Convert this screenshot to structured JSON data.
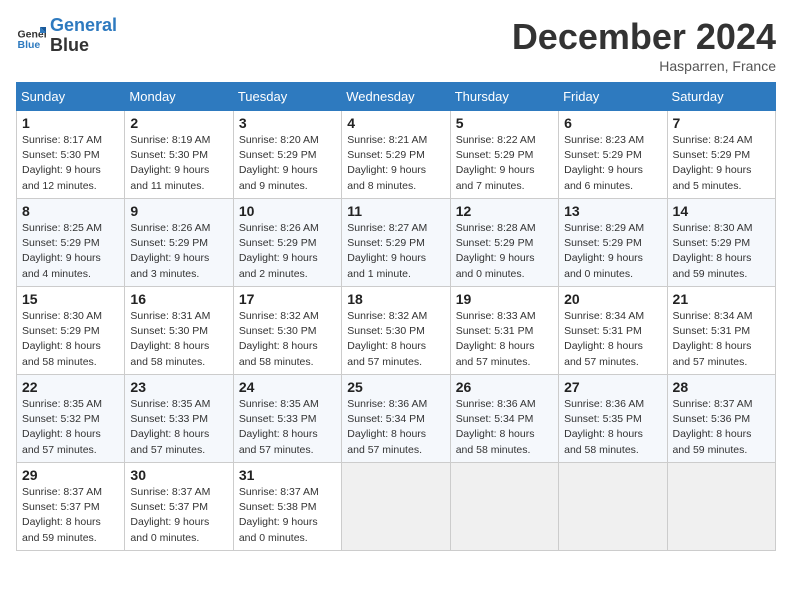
{
  "header": {
    "logo_line1": "General",
    "logo_line2": "Blue",
    "month": "December 2024",
    "location": "Hasparren, France"
  },
  "weekdays": [
    "Sunday",
    "Monday",
    "Tuesday",
    "Wednesday",
    "Thursday",
    "Friday",
    "Saturday"
  ],
  "weeks": [
    [
      {
        "day": 1,
        "sunrise": "8:17 AM",
        "sunset": "5:30 PM",
        "daylight": "9 hours and 12 minutes."
      },
      {
        "day": 2,
        "sunrise": "8:19 AM",
        "sunset": "5:30 PM",
        "daylight": "9 hours and 11 minutes."
      },
      {
        "day": 3,
        "sunrise": "8:20 AM",
        "sunset": "5:29 PM",
        "daylight": "9 hours and 9 minutes."
      },
      {
        "day": 4,
        "sunrise": "8:21 AM",
        "sunset": "5:29 PM",
        "daylight": "9 hours and 8 minutes."
      },
      {
        "day": 5,
        "sunrise": "8:22 AM",
        "sunset": "5:29 PM",
        "daylight": "9 hours and 7 minutes."
      },
      {
        "day": 6,
        "sunrise": "8:23 AM",
        "sunset": "5:29 PM",
        "daylight": "9 hours and 6 minutes."
      },
      {
        "day": 7,
        "sunrise": "8:24 AM",
        "sunset": "5:29 PM",
        "daylight": "9 hours and 5 minutes."
      }
    ],
    [
      {
        "day": 8,
        "sunrise": "8:25 AM",
        "sunset": "5:29 PM",
        "daylight": "9 hours and 4 minutes."
      },
      {
        "day": 9,
        "sunrise": "8:26 AM",
        "sunset": "5:29 PM",
        "daylight": "9 hours and 3 minutes."
      },
      {
        "day": 10,
        "sunrise": "8:26 AM",
        "sunset": "5:29 PM",
        "daylight": "9 hours and 2 minutes."
      },
      {
        "day": 11,
        "sunrise": "8:27 AM",
        "sunset": "5:29 PM",
        "daylight": "9 hours and 1 minute."
      },
      {
        "day": 12,
        "sunrise": "8:28 AM",
        "sunset": "5:29 PM",
        "daylight": "9 hours and 0 minutes."
      },
      {
        "day": 13,
        "sunrise": "8:29 AM",
        "sunset": "5:29 PM",
        "daylight": "9 hours and 0 minutes."
      },
      {
        "day": 14,
        "sunrise": "8:30 AM",
        "sunset": "5:29 PM",
        "daylight": "8 hours and 59 minutes."
      }
    ],
    [
      {
        "day": 15,
        "sunrise": "8:30 AM",
        "sunset": "5:29 PM",
        "daylight": "8 hours and 58 minutes."
      },
      {
        "day": 16,
        "sunrise": "8:31 AM",
        "sunset": "5:30 PM",
        "daylight": "8 hours and 58 minutes."
      },
      {
        "day": 17,
        "sunrise": "8:32 AM",
        "sunset": "5:30 PM",
        "daylight": "8 hours and 58 minutes."
      },
      {
        "day": 18,
        "sunrise": "8:32 AM",
        "sunset": "5:30 PM",
        "daylight": "8 hours and 57 minutes."
      },
      {
        "day": 19,
        "sunrise": "8:33 AM",
        "sunset": "5:31 PM",
        "daylight": "8 hours and 57 minutes."
      },
      {
        "day": 20,
        "sunrise": "8:34 AM",
        "sunset": "5:31 PM",
        "daylight": "8 hours and 57 minutes."
      },
      {
        "day": 21,
        "sunrise": "8:34 AM",
        "sunset": "5:31 PM",
        "daylight": "8 hours and 57 minutes."
      }
    ],
    [
      {
        "day": 22,
        "sunrise": "8:35 AM",
        "sunset": "5:32 PM",
        "daylight": "8 hours and 57 minutes."
      },
      {
        "day": 23,
        "sunrise": "8:35 AM",
        "sunset": "5:33 PM",
        "daylight": "8 hours and 57 minutes."
      },
      {
        "day": 24,
        "sunrise": "8:35 AM",
        "sunset": "5:33 PM",
        "daylight": "8 hours and 57 minutes."
      },
      {
        "day": 25,
        "sunrise": "8:36 AM",
        "sunset": "5:34 PM",
        "daylight": "8 hours and 57 minutes."
      },
      {
        "day": 26,
        "sunrise": "8:36 AM",
        "sunset": "5:34 PM",
        "daylight": "8 hours and 58 minutes."
      },
      {
        "day": 27,
        "sunrise": "8:36 AM",
        "sunset": "5:35 PM",
        "daylight": "8 hours and 58 minutes."
      },
      {
        "day": 28,
        "sunrise": "8:37 AM",
        "sunset": "5:36 PM",
        "daylight": "8 hours and 59 minutes."
      }
    ],
    [
      {
        "day": 29,
        "sunrise": "8:37 AM",
        "sunset": "5:37 PM",
        "daylight": "8 hours and 59 minutes."
      },
      {
        "day": 30,
        "sunrise": "8:37 AM",
        "sunset": "5:37 PM",
        "daylight": "9 hours and 0 minutes."
      },
      {
        "day": 31,
        "sunrise": "8:37 AM",
        "sunset": "5:38 PM",
        "daylight": "9 hours and 0 minutes."
      },
      null,
      null,
      null,
      null
    ]
  ]
}
